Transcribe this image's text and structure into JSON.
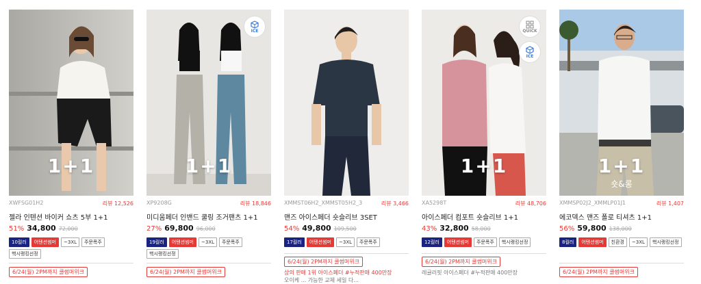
{
  "products": [
    {
      "code": "XWFSG01H2",
      "review": "리뷰 12,526",
      "name": "젤라 인텐션 바이커 쇼츠 5부 1+1",
      "discount": "51%",
      "price": "34,800",
      "original": "72,000",
      "promo": "1+1",
      "tags": [
        "10컬러",
        "어텐션썸머",
        "~3XL",
        "주문폭주",
        "핵시랭킹선정"
      ],
      "deadline": "6/24(월) 2PM까지 쿨썸머위크"
    },
    {
      "code": "XP9208G",
      "review": "리뷰 18,846",
      "name": "미디움페더 인밴드 쿨링 조거팬츠 1+1",
      "discount": "27%",
      "price": "69,800",
      "original": "96,000",
      "promo": "1+1",
      "badge": "ICE",
      "tags": [
        "19컬러",
        "어텐션썸머",
        "~3XL",
        "주문폭주",
        "핵시랭킹선정"
      ],
      "deadline": "6/24(월) 2PM까지 쿨썸머위크"
    },
    {
      "code": "XMMST06H2_XMMST05H2_3",
      "review": "리뷰 3,466",
      "name": "맨즈 아이스페더 숏슬리브 3SET",
      "discount": "54%",
      "price": "49,800",
      "original": "109,500",
      "tags": [
        "17컬러",
        "어텐션썸머",
        "~3XL",
        "주문폭주"
      ],
      "deadline": "6/24(월) 2PM까지 쿨썸머위크",
      "ship_line1": "상의 판매 1위 아이스페더 #누적판매 400만장",
      "ship_line2": "오이케 ... 가능한 교체 세일 다..."
    },
    {
      "code": "XA5298T",
      "review": "리뷰 48,706",
      "name": "아이스페더 컴포트 숏슬리브 1+1",
      "discount": "43%",
      "price": "32,800",
      "original": "58,000",
      "promo": "1+1",
      "badges": [
        "QUICK",
        "ICE"
      ],
      "tags": [
        "12컬러",
        "어텐션썸머",
        "주문폭주",
        "핵시랭킹선정"
      ],
      "deadline": "6/24(월) 2PM까지 쿨썸머위크",
      "ship_line1": "레귤러핏 아이스페더 #누적판매 400만장"
    },
    {
      "code": "XMMSP02J2_XMMLP01J1",
      "review": "리뷰 1,407",
      "name": "에코덱스 맨즈 폴로 티셔츠 1+1",
      "discount": "56%",
      "price": "59,800",
      "original": "138,000",
      "promo": "1+1",
      "promo_sub": "숏&롱",
      "tags": [
        "8컬러",
        "어텐션썸머",
        "친환경",
        "~3XL",
        "핵시랭킹선정"
      ],
      "deadline": "6/24(월) 2PM까지 쿨썸머위크"
    }
  ],
  "colors": {
    "accent": "#e53935",
    "navy": "#1a237e",
    "ice": "#3a78d8"
  }
}
